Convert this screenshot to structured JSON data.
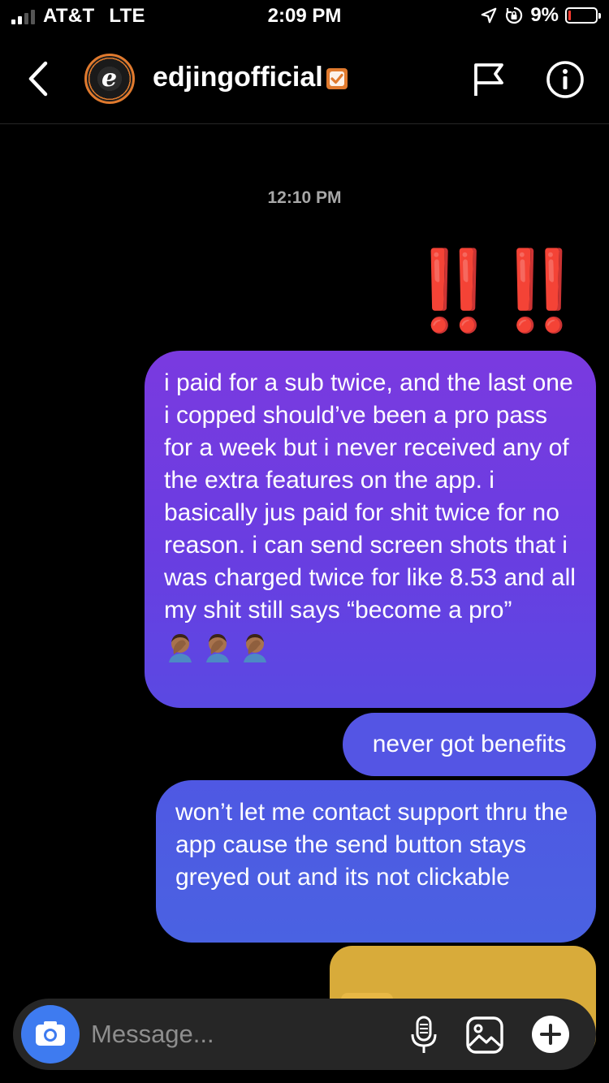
{
  "status_bar": {
    "carrier": "AT&T",
    "network": "LTE",
    "time": "2:09 PM",
    "battery_percent": "9%",
    "icons": [
      "signal-icon",
      "location-arrow-icon",
      "orientation-lock-icon",
      "battery-icon"
    ],
    "battery_color": "#ff3b30"
  },
  "header": {
    "username": "edjingofficial",
    "avatar_letter": "e",
    "icons": [
      "back-arrow-icon",
      "avatar-icon",
      "verified-badge-icon",
      "flag-icon",
      "info-icon"
    ],
    "verified_color": "#e07a2e"
  },
  "conversation": {
    "timestamp": "12:10 PM",
    "emoji_message": "‼️‼️",
    "messages": [
      {
        "text": "i paid for a sub twice, and the last one i copped should’ve been a pro pass for a week but i never received any of the extra features on the app. i basically jus paid for shit twice for no reason. i can send screen shots that i was charged twice for like 8.53 and all my shit still says “become a pro”",
        "emoji": "🤦🏾‍♂️🤦🏾‍♂️🤦🏾‍♂️"
      },
      {
        "text": "never got benefits"
      },
      {
        "text": "won’t let me contact support thru the app cause the send button stays greyed out and its not clickable"
      }
    ],
    "bubble_colors": [
      "#7a3ae0",
      "#5455e4",
      "#4a62e2"
    ],
    "media_bubble_color": "#d8ab3a"
  },
  "composer": {
    "placeholder": "Message...",
    "icons": [
      "camera-icon",
      "microphone-icon",
      "gallery-icon",
      "plus-icon"
    ],
    "camera_color": "#3e7bf0"
  }
}
